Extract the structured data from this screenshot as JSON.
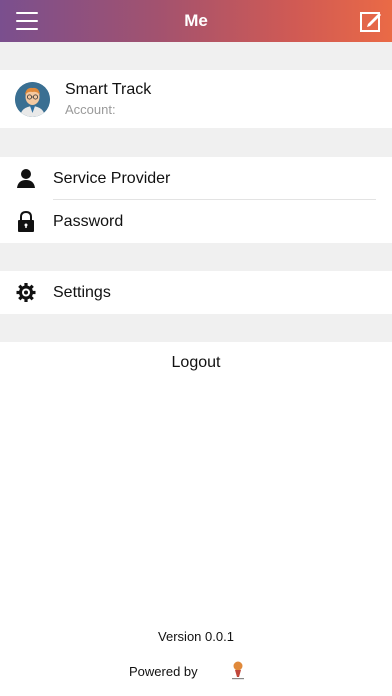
{
  "header": {
    "title": "Me"
  },
  "profile": {
    "name": "Smart Track",
    "account_label": "Account:"
  },
  "menu": {
    "items": [
      {
        "label": "Service Provider",
        "icon": "person-icon"
      },
      {
        "label": "Password",
        "icon": "lock-icon"
      },
      {
        "label": "Settings",
        "icon": "gear-icon"
      }
    ]
  },
  "logout_label": "Logout",
  "footer": {
    "version": "Version 0.0.1",
    "powered_by": "Powered by"
  },
  "colors": {
    "header_gradient": [
      "#7a4f8e",
      "#a2526f",
      "#d05a54",
      "#ea6a46"
    ],
    "background": "#f0f0f0",
    "card": "#ffffff",
    "text": "#111111",
    "muted": "#9a9a9a"
  }
}
